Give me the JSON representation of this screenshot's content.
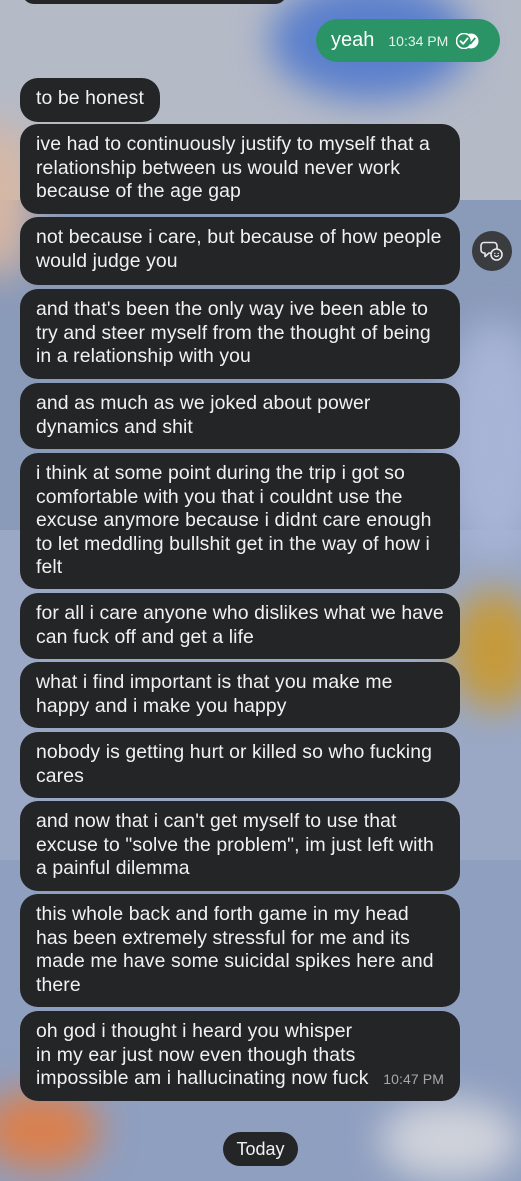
{
  "sent_message": {
    "text": "yeah",
    "time": "10:34 PM",
    "status_icon": "double-check-icon"
  },
  "received_messages": [
    {
      "text": "to be honest"
    },
    {
      "text": "ive had to continuously justify to myself that a relationship between us would never work because of the age gap"
    },
    {
      "text": "not because i care, but because of how people would judge you"
    },
    {
      "text": "and that's been the only way ive been able to try and steer myself from the thought of being in a relationship with you"
    },
    {
      "text": "and as much as we joked about power dynamics and shit"
    },
    {
      "text": "i think at some point during the trip i got so comfortable with you that i couldnt use the excuse anymore because i didnt care enough to let meddling bullshit get in the way of how i felt"
    },
    {
      "text": "for all i care anyone who dislikes what we have can fuck off and get a life"
    },
    {
      "text": "what i find important is that you make me happy and i make you happy"
    },
    {
      "text": "nobody is getting hurt or killed so who fucking cares"
    },
    {
      "text": "and now that i can't get myself to use that excuse to \"solve the problem\", im just left with a painful dilemma"
    },
    {
      "text": "this whole back and forth game in my head has been extremely stressful for me and its made me have some suicidal spikes here and there"
    },
    {
      "text": "oh god i thought i heard you whisper in my ear just now even though thats impossible am i hallucinating now fuck",
      "time": "10:47 PM"
    }
  ],
  "date_divider": {
    "label": "Today"
  },
  "icons": {
    "reaction_button": "add-reaction-icon"
  },
  "colors": {
    "sent_bubble": "#2a9466",
    "received_bubble": "#242527",
    "text": "#f1f1f1"
  }
}
